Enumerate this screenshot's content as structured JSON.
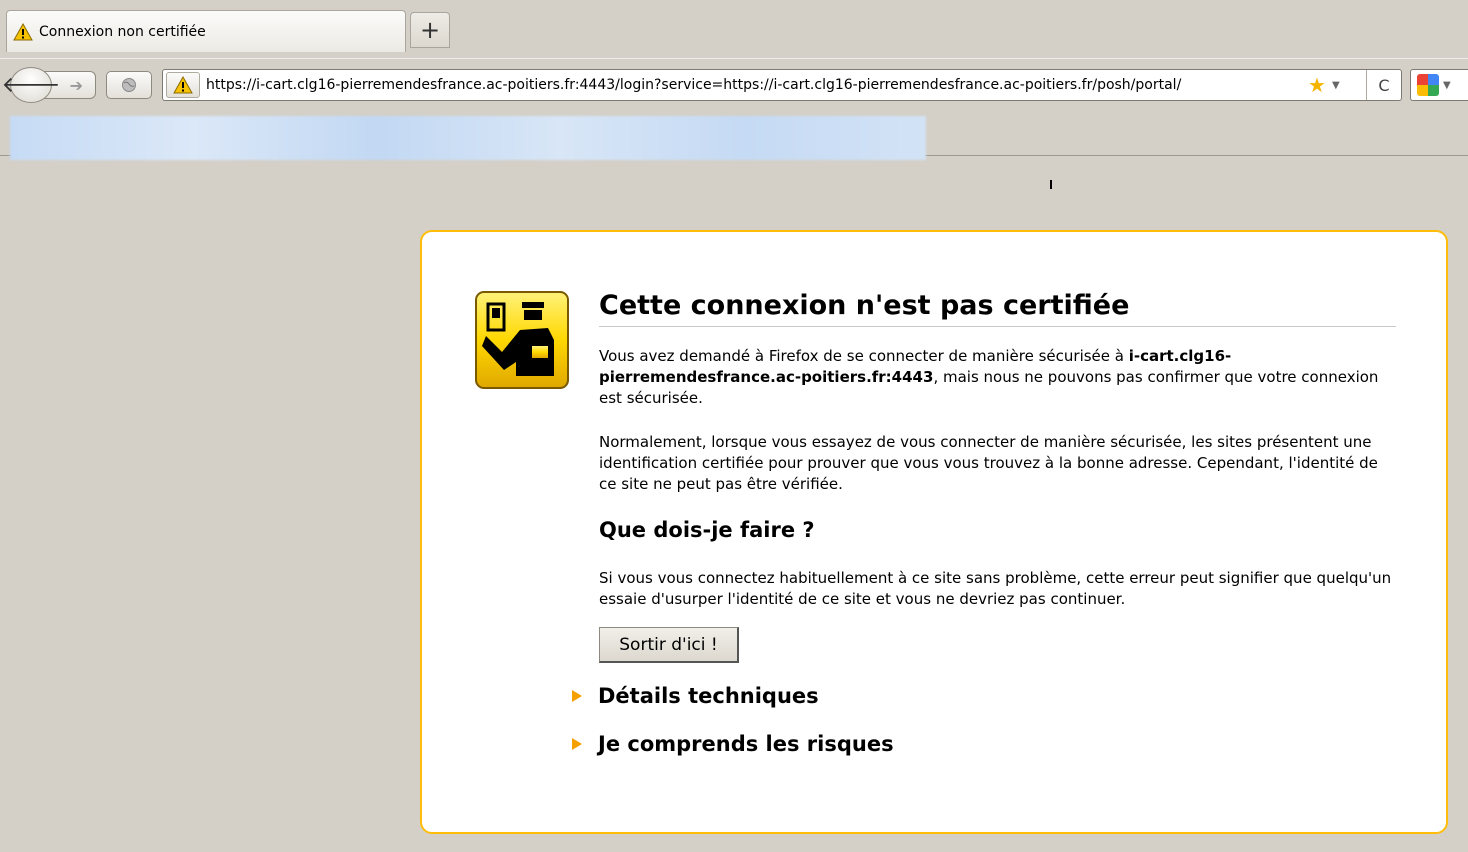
{
  "tab": {
    "title": "Connexion non certifiée",
    "newtab_label": "+"
  },
  "nav": {
    "back_label": "🡐",
    "forward_label": "➔",
    "url": "https://i-cart.clg16-pierremendesfrance.ac-poitiers.fr:4443/login?service=https://i-cart.clg16-pierremendesfrance.ac-poitiers.fr/posh/portal/",
    "reload_label": "C"
  },
  "error": {
    "title": "Cette connexion n'est pas certifiée",
    "intro_before": "Vous avez demandé à Firefox de se connecter de manière sécurisée à ",
    "host": "i-cart.clg16-pierremendesfrance.ac-poitiers.fr:4443",
    "intro_after": ", mais nous ne pouvons pas confirmer que votre connexion est sécurisée.",
    "explanation": "Normalement, lorsque vous essayez de vous connecter de manière sécurisée, les sites présentent une identification certifiée pour prouver que vous vous trouvez à la bonne adresse. Cependant, l'identité de ce site ne peut pas être vérifiée.",
    "what_to_do_title": "Que dois-je faire ?",
    "what_to_do_text": "Si vous vous connectez habituellement à ce site sans problème, cette erreur peut signifier que quelqu'un essaie d'usurper l'identité de ce site et vous ne devriez pas continuer.",
    "exit_button": "Sortir d'ici !",
    "technical_details": "Détails techniques",
    "understand_risks": "Je comprends les risques"
  },
  "colors": {
    "card_border": "#ffbd09",
    "expander_arrow": "#f5a000",
    "icon_yellow": "#ffd800"
  }
}
